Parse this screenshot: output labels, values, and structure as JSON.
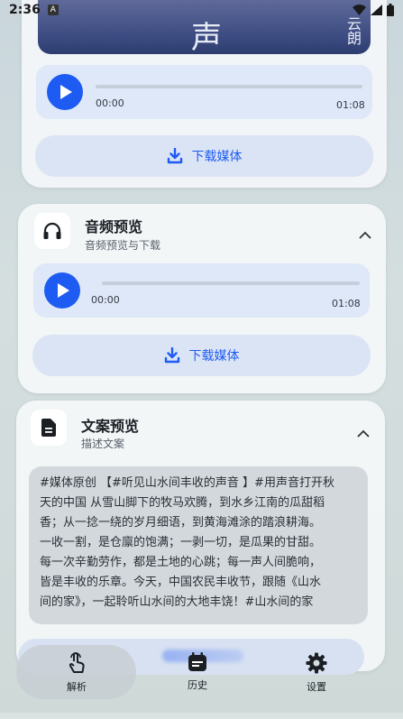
{
  "status_bar": {
    "time": "2:36",
    "app_badge": "A",
    "icons": [
      "wifi-icon",
      "signal-icon",
      "battery-icon"
    ]
  },
  "video_card": {
    "cover_text_1": "声",
    "cover_text_2": "云朗",
    "player": {
      "elapsed": "00:00",
      "duration": "01:08",
      "progress": 0
    },
    "download_label": "下载媒体"
  },
  "audio_card": {
    "title": "音频预览",
    "subtitle": "音频预览与下载",
    "icon": "headphones-icon",
    "player": {
      "elapsed": "00:00",
      "duration": "01:08",
      "progress": 0
    },
    "download_label": "下载媒体"
  },
  "text_card": {
    "title": "文案预览",
    "subtitle": "描述文案",
    "icon": "document-icon",
    "lines": [
      "#媒体原创 【#听见山水间丰收的声音 】#用声音打开秋",
      "天的中国 从雪山脚下的牧马欢腾，到水乡江南的瓜甜稻",
      "香；从一捻一绕的岁月细语，到黄海滩涂的踏浪耕海。",
      "一收一割，是仓廪的饱满；一剥一切，是瓜果的甘甜。",
      "每一次辛勤劳作，都是土地的心跳；每一声人间脆响，",
      "皆是丰收的乐章。今天，中国农民丰收节，跟随《山水",
      "间的家》，一起聆听山水间的大地丰饶！#山水间的家"
    ]
  },
  "tabs": [
    {
      "label": "解析",
      "icon": "tap-hand-icon",
      "active": true
    },
    {
      "label": "历史",
      "icon": "calendar-icon",
      "active": false
    },
    {
      "label": "设置",
      "icon": "gear-icon",
      "active": false
    }
  ],
  "colors": {
    "accent": "#1d5bf2",
    "player_bg": "#dfe8f8"
  }
}
